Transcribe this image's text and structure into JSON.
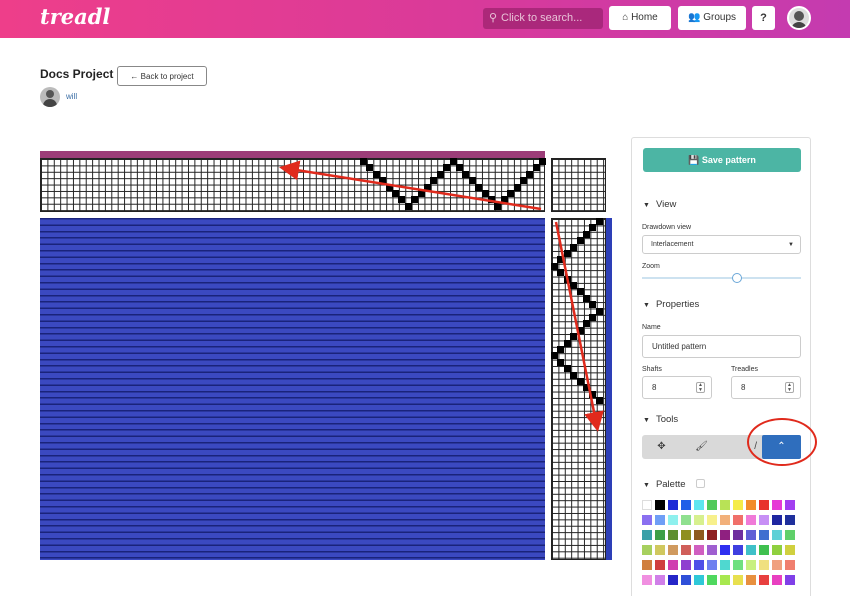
{
  "app": {
    "logo": "treadl"
  },
  "header": {
    "search_placeholder": "Click to search...",
    "home_label": "Home",
    "groups_label": "Groups",
    "help_label": "?"
  },
  "page": {
    "title": "Docs Project",
    "back_label": "Back to project",
    "username": "will"
  },
  "colors": {
    "brand_gradient_start": "#ee3e8a",
    "brand_gradient_end": "#c43bb0",
    "warp_color": "#9c3d78",
    "weft_color": "#2d3fb7",
    "save_button": "#4cb5a4",
    "active_tool": "#2f6ebd",
    "annotation": "#e02a1c"
  },
  "sidebar": {
    "save_label": "Save pattern",
    "view": {
      "heading": "View",
      "drawdown_label": "Drawdown view",
      "drawdown_value": "Interlacement",
      "zoom_label": "Zoom",
      "zoom_level": 0.6
    },
    "properties": {
      "heading": "Properties",
      "name_label": "Name",
      "name_value": "Untitled pattern",
      "shafts_label": "Shafts",
      "shafts_value": "8",
      "treadles_label": "Treadles",
      "treadles_value": "8"
    },
    "tools": {
      "heading": "Tools",
      "items": [
        {
          "name": "move-icon",
          "glyph": "✥"
        },
        {
          "name": "brush-icon",
          "glyph": "🖌"
        },
        {
          "name": "line-icon",
          "glyph": "/"
        },
        {
          "name": "chevron-up-icon",
          "glyph": "⌃"
        }
      ]
    },
    "palette": {
      "heading": "Palette",
      "swatches": [
        "#ffffff",
        "#000000",
        "#1e2ad6",
        "#1f5fe8",
        "#5fe6f0",
        "#52c95a",
        "#b8e256",
        "#f5ec4a",
        "#f28c2b",
        "#e8322c",
        "#e63ad6",
        "#a23ff0",
        "#8a6ff0",
        "#6f9ef6",
        "#8ef0ee",
        "#8fe08f",
        "#d7f08f",
        "#f7f08c",
        "#f2b07a",
        "#f0706a",
        "#f07ad8",
        "#c78ff5",
        "#1f26a0",
        "#1f2f9c",
        "#3aa0a8",
        "#3f9f45",
        "#5f8f2f",
        "#8f8f1f",
        "#8f5a1f",
        "#8f2020",
        "#8f2080",
        "#6f2f9f",
        "#5f5fd6",
        "#3f6fd0",
        "#5fd0d6",
        "#5fd06a",
        "#a7d05f",
        "#d0c85f",
        "#d09a5f",
        "#d05f5a",
        "#d05fc0",
        "#9f5fd0",
        "#2f2ff0",
        "#3f3fe0",
        "#3fc0c8",
        "#3fc04f",
        "#8fd03f",
        "#d0d03f",
        "#d07f3f",
        "#d03f3f",
        "#d03fb0",
        "#8f3fd0",
        "#4f4fe8",
        "#6f7ff0",
        "#4fd8d0",
        "#6fe07f",
        "#c8f07f",
        "#f0e07f",
        "#f0a07f",
        "#f07f6f",
        "#f08fe0",
        "#d07fe8",
        "#2525c8",
        "#2f4fd8",
        "#2fc8d8",
        "#4fd85f",
        "#a8e84f",
        "#e8e04f",
        "#e8903f",
        "#e8403f",
        "#e840c0",
        "#8040e8"
      ]
    }
  },
  "draft": {
    "threading": [
      0,
      1,
      2,
      3,
      4,
      5,
      6,
      7,
      6,
      5,
      4,
      3,
      2,
      1,
      0,
      1,
      2,
      3,
      4,
      5,
      6,
      7,
      6,
      5,
      4,
      3,
      2,
      1,
      0
    ],
    "treadling": [
      7,
      6,
      5,
      4,
      3,
      2,
      1,
      0,
      1,
      2,
      3,
      4,
      5,
      6,
      7,
      6,
      5,
      4,
      3,
      2,
      1,
      0,
      1,
      2,
      3,
      4,
      5,
      6,
      7
    ]
  }
}
